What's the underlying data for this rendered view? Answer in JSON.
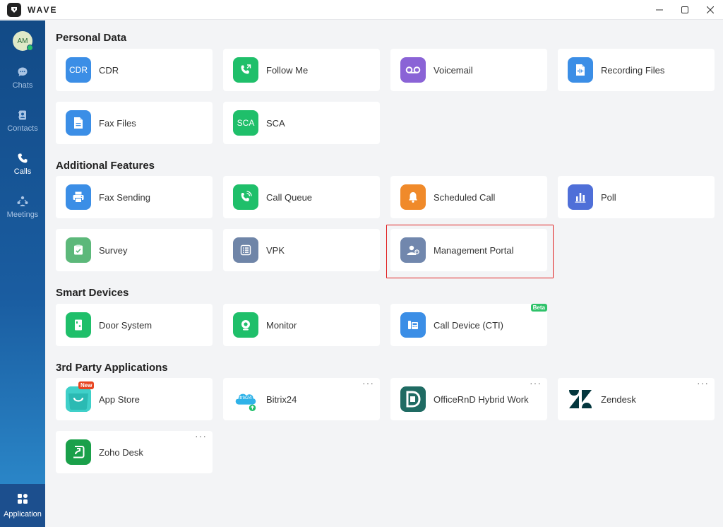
{
  "app": {
    "name": "WAVE"
  },
  "user": {
    "initials": "AM",
    "presence_color": "#27c06a"
  },
  "nav": {
    "items": [
      {
        "label": "Chats",
        "icon": "chat-icon",
        "active": false
      },
      {
        "label": "Contacts",
        "icon": "contacts-icon",
        "active": false
      },
      {
        "label": "Calls",
        "icon": "phone-icon",
        "active": true
      },
      {
        "label": "Meetings",
        "icon": "meetings-icon",
        "active": false
      }
    ],
    "application": {
      "label": "Application",
      "icon": "apps-grid-icon",
      "active": true
    }
  },
  "sections": [
    {
      "title": "Personal Data"
    },
    {
      "title": "Additional Features"
    },
    {
      "title": "Smart Devices"
    },
    {
      "title": "3rd Party Applications"
    }
  ],
  "cards": {
    "personal": [
      {
        "label": "CDR",
        "icon_text": "CDR",
        "color": "#3b8ee6"
      },
      {
        "label": "Follow Me",
        "icon": "forward-call-icon",
        "color": "#1fbf6a"
      },
      {
        "label": "Voicemail",
        "icon": "voicemail-icon",
        "color": "#8a63d6"
      },
      {
        "label": "Recording Files",
        "icon": "recording-file-icon",
        "color": "#3b8ee6"
      },
      {
        "label": "Fax Files",
        "icon": "fax-file-icon",
        "color": "#3b8ee6"
      },
      {
        "label": "SCA",
        "icon_text": "SCA",
        "color": "#1fbf6a"
      }
    ],
    "additional": [
      {
        "label": "Fax Sending",
        "icon": "printer-icon",
        "color": "#3b8ee6"
      },
      {
        "label": "Call Queue",
        "icon": "call-queue-icon",
        "color": "#1fbf6a"
      },
      {
        "label": "Scheduled Call",
        "icon": "bell-icon",
        "color": "#f08a2a"
      },
      {
        "label": "Poll",
        "icon": "poll-chart-icon",
        "color": "#4f6fd8"
      },
      {
        "label": "Survey",
        "icon": "survey-icon",
        "color": "#5cb87a"
      },
      {
        "label": "VPK",
        "icon": "keypad-icon",
        "color": "#6f85a8"
      },
      {
        "label": "Management Portal",
        "icon": "management-user-icon",
        "color": "#7187ad"
      }
    ],
    "devices": [
      {
        "label": "Door System",
        "icon": "door-icon",
        "color": "#1fbf6a"
      },
      {
        "label": "Monitor",
        "icon": "webcam-icon",
        "color": "#1fbf6a"
      },
      {
        "label": "Call Device (CTI)",
        "icon": "desk-phone-icon",
        "color": "#3b8ee6",
        "badge": "Beta"
      }
    ],
    "third_party": [
      {
        "label": "App Store",
        "icon": "app-store-icon",
        "color": "#2fc7c0",
        "badge": "New"
      },
      {
        "label": "Bitrix24",
        "icon": "bitrix24-logo-icon",
        "icon_text": "bitrix24",
        "color": "#2fb2e8",
        "more": "···"
      },
      {
        "label": "OfficeRnD Hybrid Work",
        "icon": "officernd-logo-icon",
        "color": "#1f6b63",
        "more": "···"
      },
      {
        "label": "Zendesk",
        "icon": "zendesk-logo-icon",
        "color": "#03363d",
        "more": "···"
      },
      {
        "label": "Zoho Desk",
        "icon": "zoho-desk-icon",
        "color": "#1aa04a",
        "more": "···"
      }
    ]
  },
  "colors": {
    "badge_new": "#e8441f",
    "badge_beta": "#2fc26a",
    "highlight": "#e02020"
  }
}
